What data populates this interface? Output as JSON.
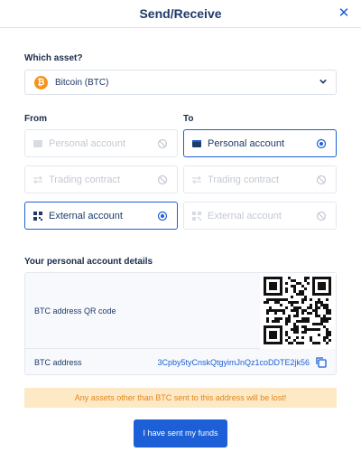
{
  "header": {
    "title": "Send/Receive",
    "close_icon": "close-icon"
  },
  "asset": {
    "label": "Which asset?",
    "selected": "Bitcoin (BTC)",
    "coin_symbol": "₿",
    "coin_color": "#f7931a"
  },
  "from": {
    "label": "From",
    "options": [
      {
        "label": "Personal account",
        "icon": "wallet-icon",
        "state": "disabled"
      },
      {
        "label": "Trading contract",
        "icon": "transfer-icon",
        "state": "disabled"
      },
      {
        "label": "External account",
        "icon": "qr-grid-icon",
        "state": "selected"
      }
    ]
  },
  "to": {
    "label": "To",
    "options": [
      {
        "label": "Personal account",
        "icon": "wallet-icon",
        "state": "selected"
      },
      {
        "label": "Trading contract",
        "icon": "transfer-icon",
        "state": "disabled"
      },
      {
        "label": "External account",
        "icon": "qr-grid-icon",
        "state": "disabled"
      }
    ]
  },
  "details": {
    "label": "Your personal account details",
    "qr_label": "BTC address QR code",
    "address_label": "BTC address",
    "address": "3Cpby5tyCnskQtgyimJnQz1coDDTE2jk56"
  },
  "warning": "Any assets other than BTC sent to this address will be lost!",
  "submit_label": "I have sent my funds",
  "colors": {
    "accent": "#1d5fd6",
    "warning_bg": "#fde9c5",
    "warning_text": "#e2871a"
  }
}
